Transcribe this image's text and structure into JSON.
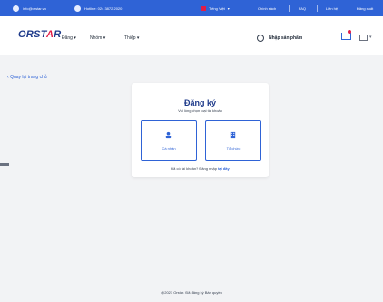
{
  "topbar": {
    "email": "info@orstar.vn",
    "hotline": "Hotline: 024 3872 2020",
    "language": "Tiếng Việt",
    "links": [
      "Chính sách",
      "FAQ",
      "Liên hệ",
      "Đăng xuất"
    ]
  },
  "navbar": {
    "logo_main": "ORST",
    "logo_accent": "A",
    "logo_end": "R",
    "menu": [
      "Đăng",
      "Nhóm",
      "Thiệp"
    ],
    "search_placeholder": "Nhập sản phẩm"
  },
  "back_link": "Quay lại trang chủ",
  "card": {
    "title": "Đăng ký",
    "subtitle": "Vui lòng chọn loại tài khoản",
    "options": [
      "Cá nhân",
      "Tổ chức"
    ],
    "footer_text": "Đã có tài khoản? Đăng nhập",
    "footer_link": "tại đây"
  },
  "footer": "@2021 Orstar. Đã đăng ký Bản quyền",
  "colors": {
    "primary": "#2f63d6",
    "accent": "#e11d48",
    "title": "#1e3a8a"
  }
}
